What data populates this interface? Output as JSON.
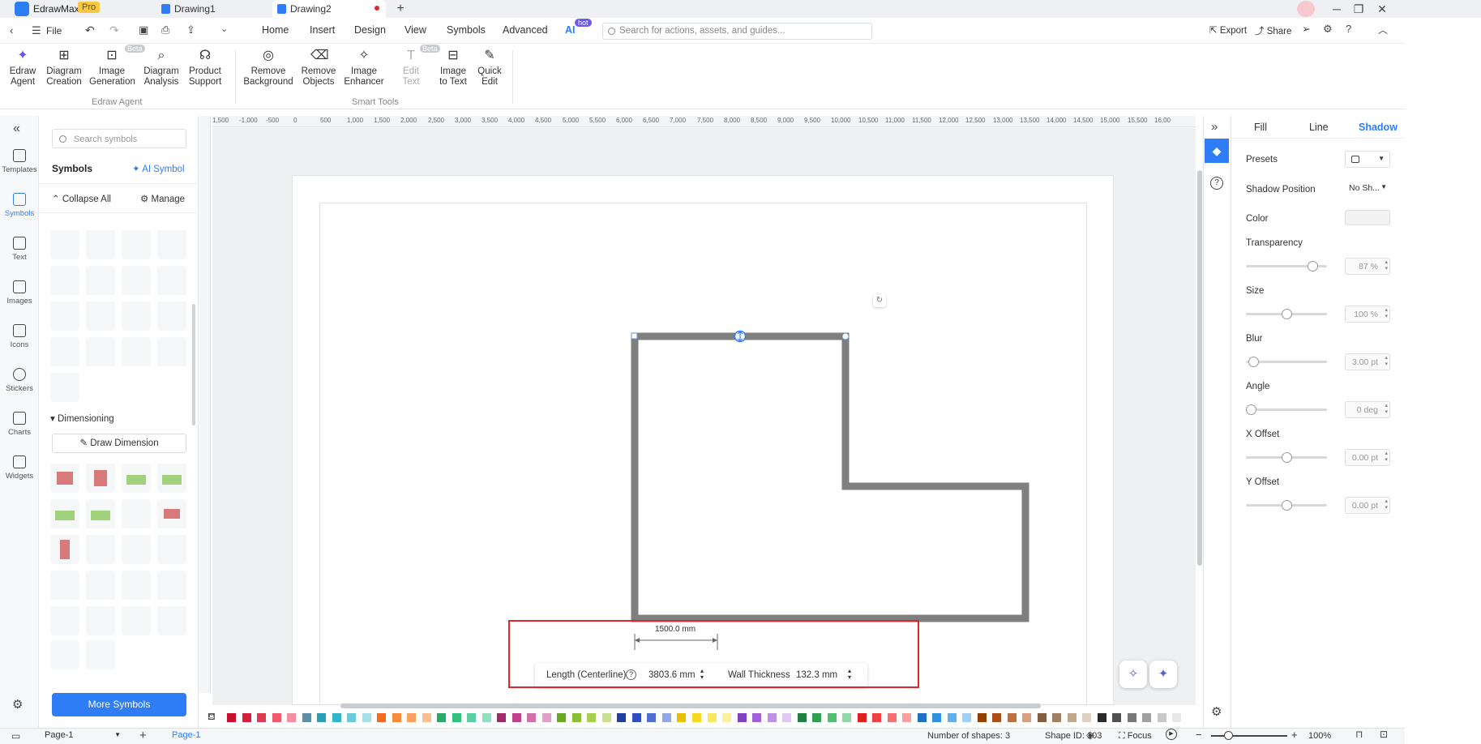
{
  "app": {
    "name": "EdrawMax",
    "badge": "Pro",
    "tabs": [
      {
        "label": "Drawing1"
      },
      {
        "label": "Drawing2"
      }
    ]
  },
  "menu": {
    "file": "File",
    "items": [
      "Home",
      "Insert",
      "Design",
      "View",
      "Symbols",
      "Advanced",
      "AI"
    ],
    "ai_badge": "hot",
    "search_placeholder": "Search for actions, assets, and guides...",
    "export": "Export",
    "share": "Share"
  },
  "ribbon": {
    "edraw_agent_group": "Edraw Agent",
    "smart_tools_group": "Smart Tools",
    "beta": "Beta",
    "buttons": [
      {
        "l1": "Edraw",
        "l2": "Agent"
      },
      {
        "l1": "Diagram",
        "l2": "Creation"
      },
      {
        "l1": "Image",
        "l2": "Generation"
      },
      {
        "l1": "Diagram",
        "l2": "Analysis"
      },
      {
        "l1": "Product",
        "l2": "Support"
      },
      {
        "l1": "Remove",
        "l2": "Background"
      },
      {
        "l1": "Remove",
        "l2": "Objects"
      },
      {
        "l1": "Image",
        "l2": "Enhancer"
      },
      {
        "l1": "Edit",
        "l2": "Text"
      },
      {
        "l1": "Image",
        "l2": "to Text"
      },
      {
        "l1": "Quick",
        "l2": "Edit"
      }
    ]
  },
  "leftbar": [
    "Templates",
    "Symbols",
    "Text",
    "Images",
    "Icons",
    "Stickers",
    "Charts",
    "Widgets"
  ],
  "symbols_panel": {
    "search_placeholder": "Search symbols",
    "title": "Symbols",
    "ai_symbol": "AI Symbol",
    "collapse_all": "Collapse All",
    "manage": "Manage",
    "section": "Dimensioning",
    "draw_dimension": "Draw Dimension",
    "more_symbols": "More Symbols"
  },
  "ruler": {
    "h_ticks": [
      "1,500",
      "-1,000",
      "-500",
      "0",
      "500",
      "1,000",
      "1,500",
      "2,000",
      "2,500",
      "3,000",
      "3,500",
      "4,000",
      "4,500",
      "5,000",
      "5,500",
      "6,000",
      "6,500",
      "7,000",
      "7,500",
      "8,000",
      "8,500",
      "9,000",
      "9,500",
      "10,000",
      "10,500",
      "11,000",
      "11,500",
      "12,000",
      "12,500",
      "13,000",
      "13,500",
      "14,000",
      "14,500",
      "15,000",
      "15,500",
      "16,00"
    ]
  },
  "canvas": {
    "dimension_label": "1500.0 mm",
    "length_label": "Length (Centerline)",
    "length_value": "3803.6 mm",
    "thickness_label": "Wall Thickness",
    "thickness_value": "132.3 mm",
    "wall_color": "#7f7f7f"
  },
  "right_panel": {
    "tabs": [
      "Fill",
      "Line",
      "Shadow"
    ],
    "active_tab": "Shadow",
    "presets": "Presets",
    "shadow_position": "Shadow Position",
    "shadow_position_value": "No Sh...",
    "color": "Color",
    "props": [
      {
        "label": "Transparency",
        "value": "87 %",
        "level": 0.87
      },
      {
        "label": "Size",
        "value": "100 %",
        "level": 0.5
      },
      {
        "label": "Blur",
        "value": "3.00 pt",
        "level": 0.03
      },
      {
        "label": "Angle",
        "value": "0 deg",
        "level": 0.0
      },
      {
        "label": "X Offset",
        "value": "0.00 pt",
        "level": 0.5
      },
      {
        "label": "Y Offset",
        "value": "0.00 pt",
        "level": 0.5
      }
    ]
  },
  "status": {
    "page_select": "Page-1",
    "page_tab": "Page-1",
    "shapes": "Number of shapes: 3",
    "shape_id": "Shape ID: 103",
    "focus": "Focus",
    "zoom": "100%"
  },
  "palette": [
    "#c8102e",
    "#d81e3a",
    "#e03a4e",
    "#f05a6e",
    "#f48fa0",
    "#5b8fa8",
    "#2a9fb8",
    "#31b6c8",
    "#6ccbd8",
    "#a4e0e8",
    "#f46a20",
    "#f88a3a",
    "#fba060",
    "#fcc090",
    "#2aaa6a",
    "#30c080",
    "#5ad0a0",
    "#90e0c0",
    "#a02a6a",
    "#c0408a",
    "#d070a8",
    "#e0a0c8",
    "#6aaa20",
    "#8ac030",
    "#a8d050",
    "#c8e090",
    "#2040a0",
    "#3050c0",
    "#5070d0",
    "#90a8e8",
    "#e8c000",
    "#f8d820",
    "#f8e860",
    "#fcf0a0",
    "#8040c0",
    "#a060d8",
    "#c090e8",
    "#e0c8f4",
    "#208040",
    "#30a050",
    "#50c070",
    "#90d8a8",
    "#e02020",
    "#f04040",
    "#f87070",
    "#fca0a0",
    "#2070c0",
    "#3090e0",
    "#60b0f0",
    "#a0d0f8",
    "#904000",
    "#a85018",
    "#c07040",
    "#d8a080",
    "#806040",
    "#a08060",
    "#c0a888",
    "#e0d0c0",
    "#2a2a2a",
    "#505050",
    "#787878",
    "#a0a0a0",
    "#c8c8c8",
    "#e8e8e8"
  ]
}
